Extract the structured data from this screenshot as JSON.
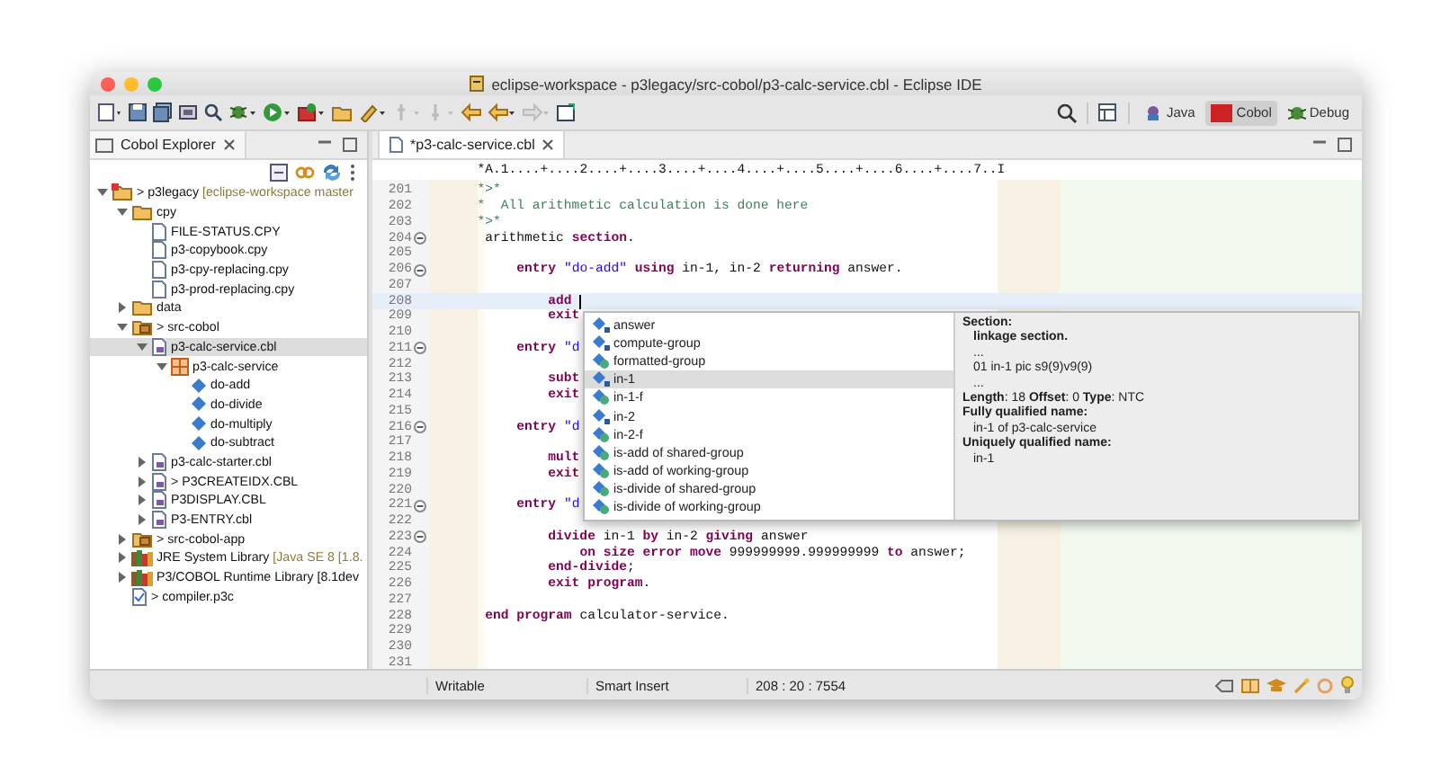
{
  "window": {
    "title": "eclipse-workspace - p3legacy/src-cobol/p3-calc-service.cbl - Eclipse IDE"
  },
  "perspectives": [
    {
      "label": "Java",
      "selected": false
    },
    {
      "label": "Cobol",
      "selected": true
    },
    {
      "label": "Debug",
      "selected": false
    }
  ],
  "explorer": {
    "title": "Cobol Explorer",
    "tree": [
      {
        "label": "> p3legacy",
        "decoration": "[eclipse-workspace master",
        "kind": "project",
        "expanded": true,
        "selected": false,
        "children": [
          {
            "label": "cpy",
            "kind": "folder",
            "expanded": true,
            "selected": false,
            "children": [
              {
                "label": "FILE-STATUS.CPY",
                "kind": "copybook",
                "selected": false
              },
              {
                "label": "p3-copybook.cpy",
                "kind": "copybook",
                "selected": false
              },
              {
                "label": "p3-cpy-replacing.cpy",
                "kind": "copybook",
                "selected": false
              },
              {
                "label": "p3-prod-replacing.cpy",
                "kind": "copybook",
                "selected": false
              }
            ]
          },
          {
            "label": "data",
            "kind": "folder",
            "expanded": false,
            "selected": false
          },
          {
            "label": "> src-cobol",
            "kind": "source-folder",
            "expanded": true,
            "selected": false,
            "children": [
              {
                "label": "p3-calc-service.cbl",
                "kind": "cobol-file",
                "expanded": true,
                "selected": true,
                "children": [
                  {
                    "label": "p3-calc-service",
                    "kind": "program",
                    "expanded": true,
                    "selected": false,
                    "children": [
                      {
                        "label": "do-add",
                        "kind": "entry",
                        "selected": false
                      },
                      {
                        "label": "do-divide",
                        "kind": "entry",
                        "selected": false
                      },
                      {
                        "label": "do-multiply",
                        "kind": "entry",
                        "selected": false
                      },
                      {
                        "label": "do-subtract",
                        "kind": "entry",
                        "selected": false
                      }
                    ]
                  }
                ]
              },
              {
                "label": "p3-calc-starter.cbl",
                "kind": "cobol-file",
                "expanded": false,
                "selected": false
              },
              {
                "label": "> P3CREATEIDX.CBL",
                "kind": "cobol-file",
                "expanded": false,
                "selected": false
              },
              {
                "label": "P3DISPLAY.CBL",
                "kind": "cobol-file",
                "expanded": false,
                "selected": false
              },
              {
                "label": "P3-ENTRY.cbl",
                "kind": "cobol-file",
                "expanded": false,
                "selected": false
              }
            ]
          },
          {
            "label": "> src-cobol-app",
            "kind": "source-folder",
            "expanded": false,
            "selected": false
          },
          {
            "label": "JRE System Library",
            "decoration": "[Java SE 8 [1.8.",
            "kind": "library",
            "expanded": false,
            "selected": false
          },
          {
            "label": "P3/COBOL Runtime Library [8.1dev",
            "kind": "library",
            "expanded": false,
            "selected": false
          },
          {
            "label": "> compiler.p3c",
            "kind": "config",
            "selected": false
          }
        ]
      }
    ]
  },
  "editor": {
    "tab": {
      "label": "*p3-calc-service.cbl"
    },
    "ruler": "*A.1....+....2....+....3....+....4....+....5....+....6....+....7..I",
    "lines": [
      {
        "number": "201",
        "fold": false,
        "current": false,
        "tokens": [
          {
            "kind": "cmt",
            "text": "      *>*"
          }
        ]
      },
      {
        "number": "202",
        "fold": false,
        "current": false,
        "tokens": [
          {
            "kind": "cmt",
            "text": "      *  All arithmetic calculation is done here"
          }
        ]
      },
      {
        "number": "203",
        "fold": false,
        "current": false,
        "tokens": [
          {
            "kind": "cmt",
            "text": "      *>*"
          }
        ]
      },
      {
        "number": "204",
        "fold": true,
        "current": false,
        "tokens": [
          {
            "kind": "txt",
            "text": "       arithmetic"
          },
          {
            "kind": "kw",
            "text": " section"
          },
          {
            "kind": "txt",
            "text": "."
          }
        ]
      },
      {
        "number": "205",
        "fold": false,
        "current": false
      },
      {
        "number": "206",
        "fold": true,
        "current": false,
        "tokens": [
          {
            "kind": "kw",
            "text": "           entry"
          },
          {
            "kind": "str",
            "text": " \"do-add\""
          },
          {
            "kind": "kw",
            "text": " using"
          },
          {
            "kind": "txt",
            "text": " in-1, in-2 "
          },
          {
            "kind": "kw",
            "text": "returning"
          },
          {
            "kind": "txt",
            "text": " answer."
          }
        ]
      },
      {
        "number": "207",
        "fold": false,
        "current": false
      },
      {
        "number": "208",
        "fold": false,
        "current": true,
        "tokens": [
          {
            "kind": "kw",
            "text": "               add"
          }
        ]
      },
      {
        "number": "209",
        "fold": false,
        "current": false,
        "tokens": [
          {
            "kind": "kw",
            "text": "               exit"
          }
        ]
      },
      {
        "number": "210",
        "fold": false,
        "current": false
      },
      {
        "number": "211",
        "fold": true,
        "current": false,
        "tokens": [
          {
            "kind": "kw",
            "text": "           entry"
          },
          {
            "kind": "str",
            "text": " \"d"
          }
        ]
      },
      {
        "number": "212",
        "fold": false,
        "current": false
      },
      {
        "number": "213",
        "fold": false,
        "current": false,
        "tokens": [
          {
            "kind": "kw",
            "text": "               subt"
          }
        ]
      },
      {
        "number": "214",
        "fold": false,
        "current": false,
        "tokens": [
          {
            "kind": "kw",
            "text": "               exit"
          }
        ]
      },
      {
        "number": "215",
        "fold": false,
        "current": false
      },
      {
        "number": "216",
        "fold": true,
        "current": false,
        "tokens": [
          {
            "kind": "kw",
            "text": "           entry"
          },
          {
            "kind": "str",
            "text": " \"d"
          }
        ]
      },
      {
        "number": "217",
        "fold": false,
        "current": false
      },
      {
        "number": "218",
        "fold": false,
        "current": false,
        "tokens": [
          {
            "kind": "kw",
            "text": "               mult"
          }
        ]
      },
      {
        "number": "219",
        "fold": false,
        "current": false,
        "tokens": [
          {
            "kind": "kw",
            "text": "               exit"
          }
        ]
      },
      {
        "number": "220",
        "fold": false,
        "current": false
      },
      {
        "number": "221",
        "fold": true,
        "current": false,
        "tokens": [
          {
            "kind": "kw",
            "text": "           entry"
          },
          {
            "kind": "str",
            "text": " \"d"
          }
        ]
      },
      {
        "number": "222",
        "fold": false,
        "current": false
      },
      {
        "number": "223",
        "fold": true,
        "current": false,
        "tokens": [
          {
            "kind": "kw",
            "text": "               divide"
          },
          {
            "kind": "txt",
            "text": " in-1 "
          },
          {
            "kind": "kw",
            "text": "by"
          },
          {
            "kind": "txt",
            "text": " in-2 "
          },
          {
            "kind": "kw",
            "text": "giving"
          },
          {
            "kind": "txt",
            "text": " answer"
          }
        ]
      },
      {
        "number": "224",
        "fold": false,
        "current": false,
        "tokens": [
          {
            "kind": "kw",
            "text": "                   on size error move"
          },
          {
            "kind": "txt",
            "text": " 999999999.999999999 "
          },
          {
            "kind": "kw",
            "text": "to"
          },
          {
            "kind": "txt",
            "text": " answer;"
          }
        ]
      },
      {
        "number": "225",
        "fold": false,
        "current": false,
        "tokens": [
          {
            "kind": "kw",
            "text": "               end-divide"
          },
          {
            "kind": "txt",
            "text": ";"
          }
        ]
      },
      {
        "number": "226",
        "fold": false,
        "current": false,
        "tokens": [
          {
            "kind": "kw",
            "text": "               exit program"
          },
          {
            "kind": "txt",
            "text": "."
          }
        ]
      },
      {
        "number": "227",
        "fold": false,
        "current": false
      },
      {
        "number": "228",
        "fold": false,
        "current": false,
        "tokens": [
          {
            "kind": "kw",
            "text": "       end program"
          },
          {
            "kind": "txt",
            "text": " calculator-service."
          }
        ]
      },
      {
        "number": "229",
        "fold": false,
        "current": false
      },
      {
        "number": "230",
        "fold": false,
        "current": false
      },
      {
        "number": "231",
        "fold": false,
        "current": false
      }
    ]
  },
  "completion": {
    "items": [
      {
        "label": "answer",
        "kind": "field",
        "selected": false
      },
      {
        "label": "compute-group",
        "kind": "field",
        "selected": false
      },
      {
        "label": "formatted-group",
        "kind": "group",
        "selected": false
      },
      {
        "label": "in-1",
        "kind": "field",
        "selected": true
      },
      {
        "label": "in-1-f",
        "kind": "group",
        "selected": false
      },
      {
        "label": "in-2",
        "kind": "field",
        "selected": false
      },
      {
        "label": "in-2-f",
        "kind": "group",
        "selected": false
      },
      {
        "label": "is-add of shared-group",
        "kind": "group",
        "selected": false
      },
      {
        "label": "is-add of working-group",
        "kind": "group",
        "selected": false
      },
      {
        "label": "is-divide of shared-group",
        "kind": "group",
        "selected": false
      },
      {
        "label": "is-divide of working-group",
        "kind": "group",
        "selected": false
      }
    ],
    "details": [
      {
        "kind": "heading",
        "text": "Section:"
      },
      {
        "kind": "indent-bold",
        "text": "linkage section."
      },
      {
        "kind": "indent",
        "text": "..."
      },
      {
        "kind": "indent",
        "text": "01 in-1 pic s9(9)v9(9)"
      },
      {
        "kind": "indent",
        "text": "..."
      },
      {
        "kind": "plain",
        "text": "**Length**: 18 **Offset**: 0 **Type**: NTC"
      },
      {
        "kind": "heading",
        "text": "Fully qualified name:"
      },
      {
        "kind": "indent",
        "text": "in-1 of p3-calc-service"
      },
      {
        "kind": "heading",
        "text": "Uniquely qualified name:"
      },
      {
        "kind": "indent",
        "text": "in-1"
      }
    ]
  },
  "status_bar": {
    "fields": [
      "Writable",
      "Smart Insert",
      "208 : 20 : 7554"
    ]
  }
}
